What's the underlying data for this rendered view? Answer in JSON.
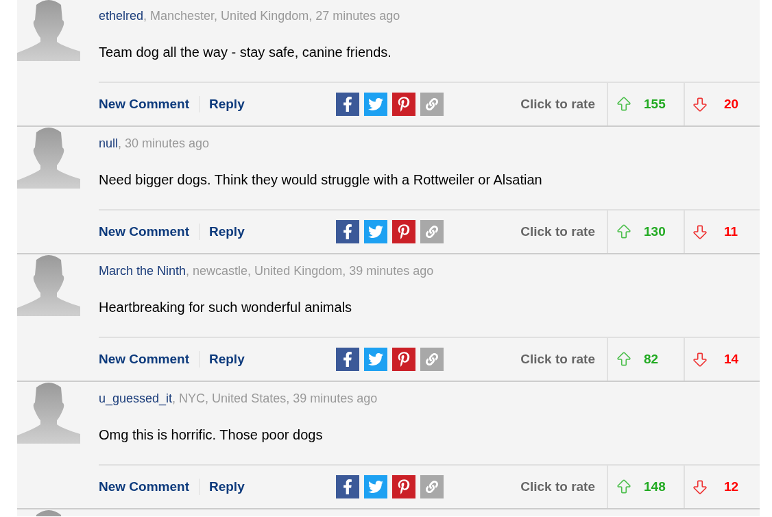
{
  "comments": [
    {
      "user": "ethelred",
      "meta": ", Manchester, United Kingdom, 27 minutes ago",
      "body": "Team dog all the way - stay safe, canine friends.",
      "new_comment": "New Comment",
      "reply": "Reply",
      "rate_label": "Click to rate",
      "up": "155",
      "down": "20"
    },
    {
      "user": "null",
      "meta": ", 30 minutes ago",
      "body": "Need bigger dogs. Think they would struggle with a Rottweiler or Alsatian",
      "new_comment": "New Comment",
      "reply": "Reply",
      "rate_label": "Click to rate",
      "up": "130",
      "down": "11"
    },
    {
      "user": "March the Ninth",
      "meta": ", newcastle, United Kingdom, 39 minutes ago",
      "body": "Heartbreaking for such wonderful animals",
      "new_comment": "New Comment",
      "reply": "Reply",
      "rate_label": "Click to rate",
      "up": "82",
      "down": "14"
    },
    {
      "user": "u_guessed_it",
      "meta": ", NYC, United States, 39 minutes ago",
      "body": "Omg this is horrific. Those poor dogs",
      "new_comment": "New Comment",
      "reply": "Reply",
      "rate_label": "Click to rate",
      "up": "148",
      "down": "12"
    }
  ]
}
